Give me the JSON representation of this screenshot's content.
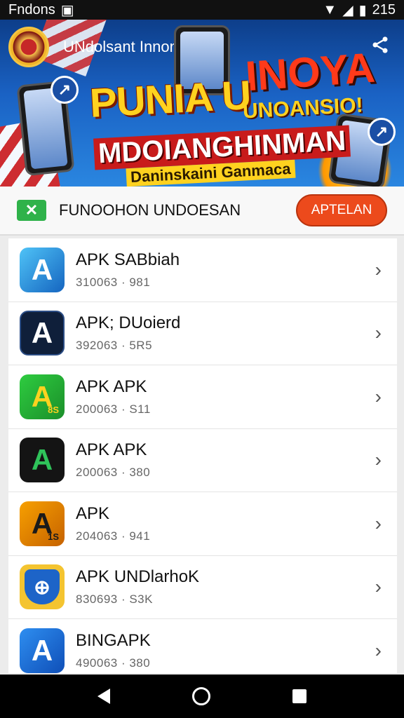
{
  "status_bar": {
    "left_text": "Fndons",
    "time": "215"
  },
  "banner": {
    "brand": "UNdolsant Innonsa",
    "headline_1": "PUNIA U",
    "headline_2": "INOYA",
    "headline_3": "UNOANSIO!",
    "headline_4": "MDOIANGHINMAN",
    "headline_5": "Daninskaini Ganmaca"
  },
  "promo": {
    "title": "FUNOOHON UNDOESAN",
    "button": "APTELAN"
  },
  "apps": [
    {
      "name": "APK SABbiah",
      "sub": "310063 · 981",
      "icon": "ic1",
      "glyph": "A"
    },
    {
      "name": "APK; DUoierd",
      "sub": "392063 · 5R5",
      "icon": "ic2",
      "glyph": "A"
    },
    {
      "name": "APK APK",
      "sub": "200063 · S11",
      "icon": "ic3",
      "glyph": "A",
      "badge": "8S"
    },
    {
      "name": "APK  APK",
      "sub": "200063 · 380",
      "icon": "ic4",
      "glyph": "A"
    },
    {
      "name": "APK",
      "sub": "204063 · 941",
      "icon": "ic5",
      "glyph": "A",
      "badge": "1S"
    },
    {
      "name": "APK UNDlarhoK",
      "sub": "830693 · S3K",
      "icon": "ic6",
      "glyph": "⊕"
    },
    {
      "name": "BINGAPK",
      "sub": "490063 · 380",
      "icon": "ic7",
      "glyph": "A"
    }
  ],
  "icons": {
    "share": "share-icon",
    "chevron": "chevron-right-icon"
  }
}
